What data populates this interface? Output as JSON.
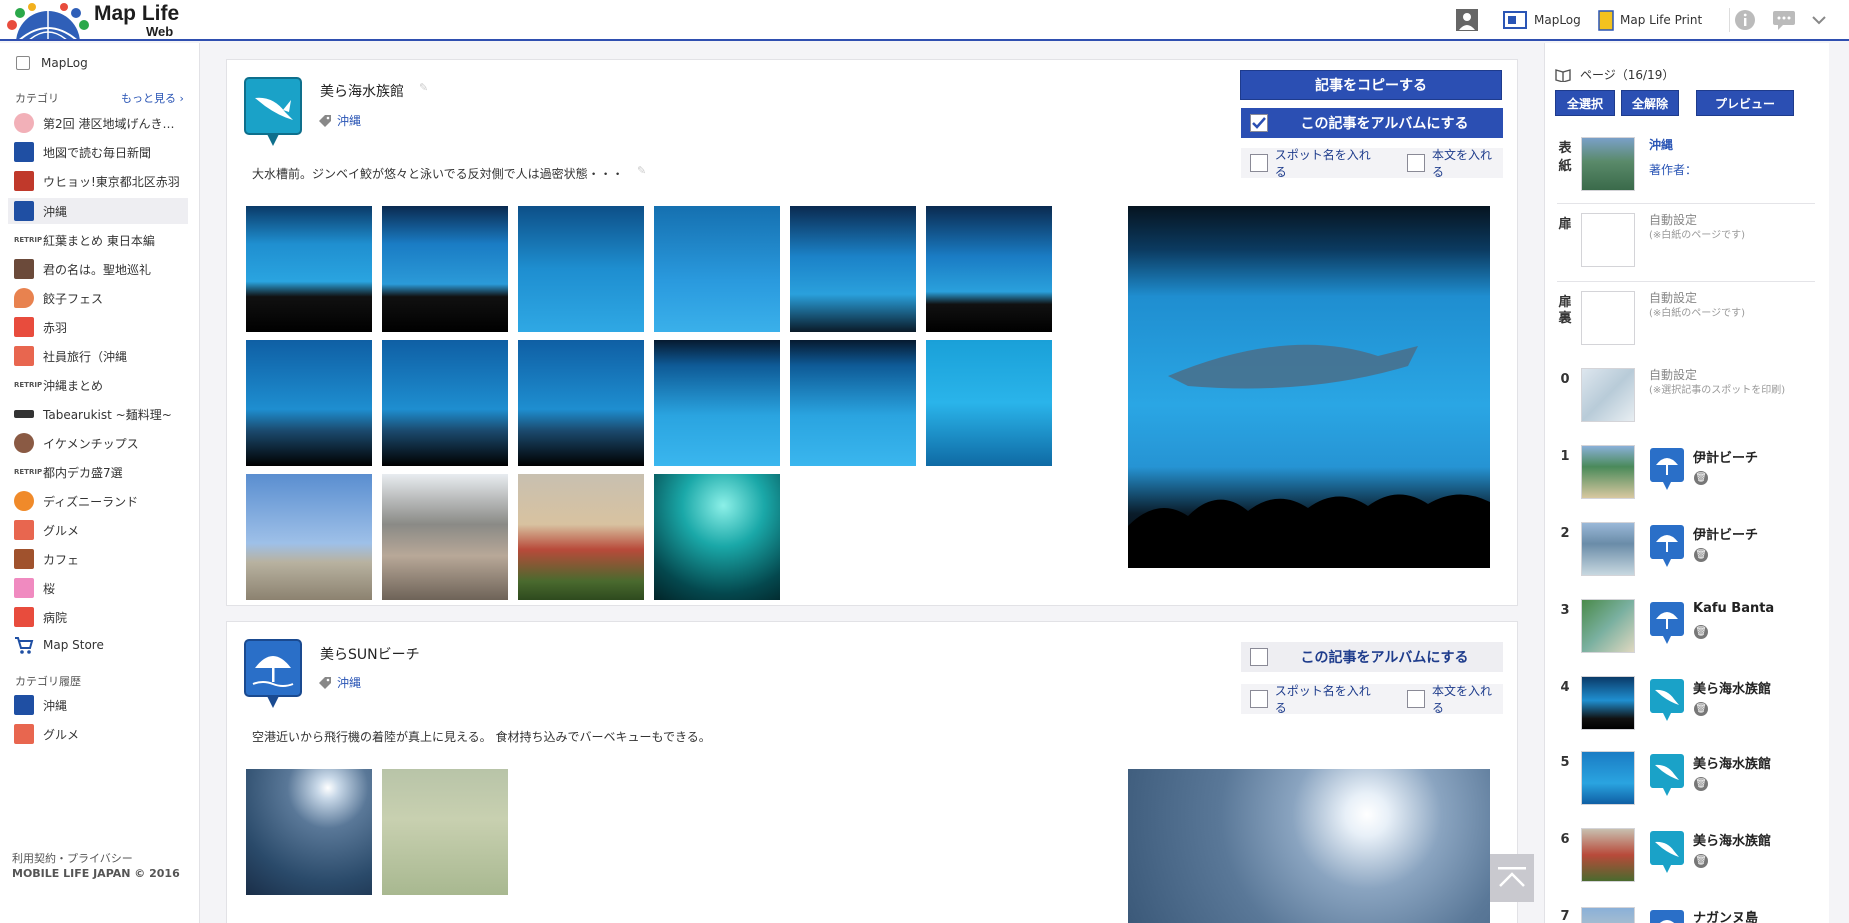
{
  "header": {
    "logo_text": "Map Life",
    "logo_sub": "Web",
    "nav": [
      {
        "label": "MapLog",
        "icon": "maplog-icon"
      },
      {
        "label": "Map Life Print",
        "icon": "print-icon"
      }
    ]
  },
  "sidebar": {
    "maplog": "MapLog",
    "category_heading": "カテゴリ",
    "more_link": "もっと見る ›",
    "categories": [
      {
        "label": "第2回 港区地域げんき…",
        "color": "#f2b0b8"
      },
      {
        "label": "地図で読む毎日新聞",
        "color": "#1f4fa3"
      },
      {
        "label": "ウヒョッ!東京都北区赤羽",
        "color": "#c0392b"
      },
      {
        "label": "沖縄",
        "color": "#1f4fa3"
      },
      {
        "label": "紅葉まとめ 東日本編",
        "color": "#555555"
      },
      {
        "label": "君の名は。聖地巡礼",
        "color": "#6b4a3a"
      },
      {
        "label": "餃子フェス",
        "color": "#e8824f"
      },
      {
        "label": "赤羽",
        "color": "#e84c3d"
      },
      {
        "label": "社員旅行（沖縄",
        "color": "#e8664f"
      },
      {
        "label": "沖縄まとめ",
        "color": "#555555"
      },
      {
        "label": "Tabearukist ~麺料理~",
        "color": "#333333"
      },
      {
        "label": "イケメンチップス",
        "color": "#8a5a44"
      },
      {
        "label": "都内デカ盛7選",
        "color": "#555555"
      },
      {
        "label": "ディズニーランド",
        "color": "#f08a2a"
      },
      {
        "label": "グルメ",
        "color": "#e8664f"
      },
      {
        "label": "カフェ",
        "color": "#a0522d"
      },
      {
        "label": "桜",
        "color": "#f08ac0"
      },
      {
        "label": "病院",
        "color": "#e84c3d"
      },
      {
        "label": "Map Store",
        "color": "#1f4fa3"
      }
    ],
    "history_heading": "カテゴリ履歴",
    "history": [
      {
        "label": "沖縄",
        "color": "#1f4fa3"
      },
      {
        "label": "グルメ",
        "color": "#e8664f"
      }
    ],
    "footer_line1": "利用契約・プライバシー",
    "footer_line2": "MOBILE LIFE JAPAN © 2016"
  },
  "articles": [
    {
      "title": "美ら海水族館",
      "tag": "沖縄",
      "body": "大水槽前。ジンベイ鮫が悠々と泳いでる反対側で人は過密状態・・・",
      "copy_button": "記事をコピーする",
      "album_label": "この記事をアルバムにする",
      "album_checked": true,
      "spot_name_label": "スポット名を入れる",
      "body_text_label": "本文を入れる"
    },
    {
      "title": "美らSUNビーチ",
      "tag": "沖縄",
      "body": "空港近いから飛行機の着陸が真上に見える。 食材持ち込みでバーベキューもできる。",
      "album_label": "この記事をアルバムにする",
      "album_checked": false,
      "spot_name_label": "スポット名を入れる",
      "body_text_label": "本文を入れる"
    }
  ],
  "right_panel": {
    "page_label": "ページ（16/19）",
    "select_all": "全選択",
    "deselect_all": "全解除",
    "preview": "プレビュー",
    "cover": {
      "label_top": "表",
      "label_bottom": "紙",
      "title": "沖縄",
      "author": "著作者："
    },
    "flyleaf": {
      "label": "扉",
      "text": "自動設定",
      "note": "(※白紙のページです)"
    },
    "flyleaf_back": {
      "label_top": "扉",
      "label_bottom": "裏",
      "text": "自動設定",
      "note": "(※白紙のページです)"
    },
    "map_page": {
      "num": "0",
      "text": "自動設定",
      "note": "(※選択記事のスポットを印刷)"
    },
    "pages": [
      {
        "num": "1",
        "name": "伊計ビーチ",
        "pin": "beach"
      },
      {
        "num": "2",
        "name": "伊計ビーチ",
        "pin": "beach"
      },
      {
        "num": "3",
        "name": "Kafu Banta",
        "pin": "beach"
      },
      {
        "num": "4",
        "name": "美ら海水族館",
        "pin": "shark"
      },
      {
        "num": "5",
        "name": "美ら海水族館",
        "pin": "shark"
      },
      {
        "num": "6",
        "name": "美ら海水族館",
        "pin": "shark"
      },
      {
        "num": "7",
        "name": "ナガンヌ島",
        "pin": "beach"
      }
    ],
    "trash_glyph": "🗑"
  }
}
